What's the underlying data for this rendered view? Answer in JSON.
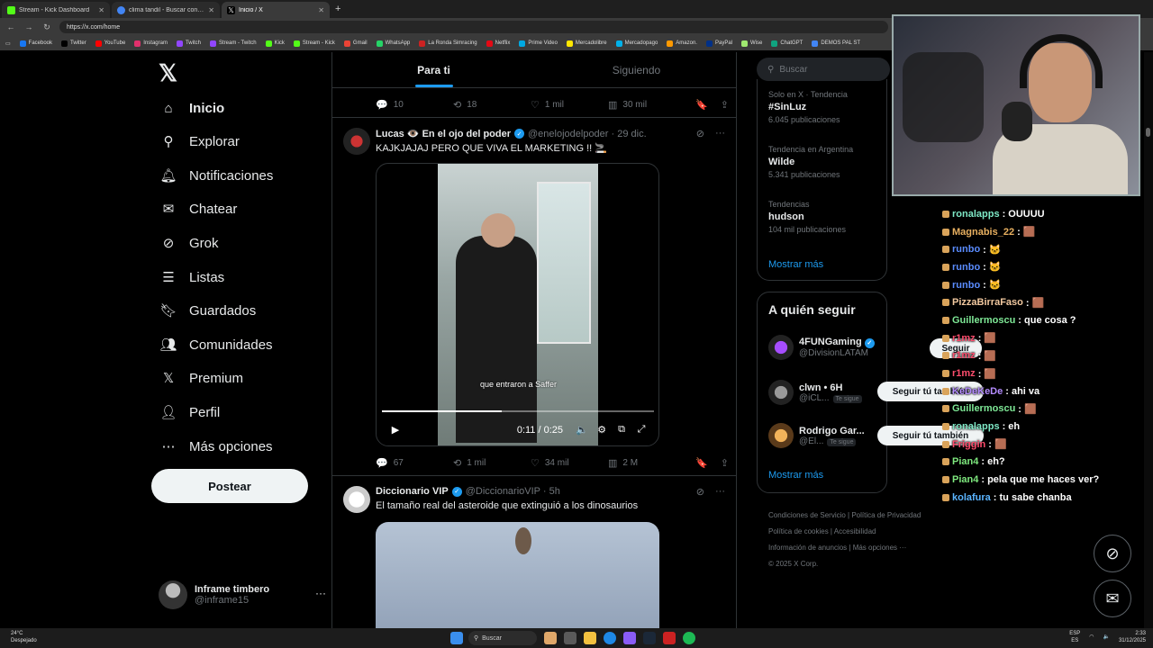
{
  "browser": {
    "tabs": [
      {
        "label": "Stream - Kick Dashboard",
        "color": "#53fc18"
      },
      {
        "label": "clima tandil - Buscar con Google",
        "color": "#4285f4"
      },
      {
        "label": "Inicio / X",
        "color": "#ffffff"
      }
    ],
    "url": "https://x.com/home",
    "bookmarks": [
      "Facebook",
      "Twitter",
      "YouTube",
      "Instagram",
      "Twitch",
      "Stream - Twitch",
      "Kick",
      "Stream - Kick",
      "Gmail",
      "WhatsApp",
      "La Ronda Simracing",
      "Netflix",
      "Prime Video",
      "Mercadolibre",
      "Mercadopago",
      "Amazon.",
      "PayPal",
      "Wise",
      "ChatGPT",
      "DEMOS PAL ST"
    ]
  },
  "nav": {
    "items": [
      {
        "label": "Inicio",
        "icon": "home-icon"
      },
      {
        "label": "Explorar",
        "icon": "search-icon"
      },
      {
        "label": "Notificaciones",
        "icon": "bell-icon"
      },
      {
        "label": "Chatear",
        "icon": "mail-icon"
      },
      {
        "label": "Grok",
        "icon": "grok-icon"
      },
      {
        "label": "Listas",
        "icon": "list-icon"
      },
      {
        "label": "Guardados",
        "icon": "bookmark-icon"
      },
      {
        "label": "Comunidades",
        "icon": "people-icon"
      },
      {
        "label": "Premium",
        "icon": "x-icon"
      },
      {
        "label": "Perfil",
        "icon": "person-icon"
      },
      {
        "label": "Más opciones",
        "icon": "more-icon"
      }
    ],
    "post_label": "Postear",
    "account": {
      "name": "Inframe timbero",
      "handle": "@inframe15"
    }
  },
  "feed": {
    "tabs": [
      "Para ti",
      "Siguiendo"
    ],
    "top_actions": {
      "replies": "10",
      "reposts": "18",
      "likes": "1 mil",
      "views": "30 mil"
    },
    "tweet1": {
      "name": "Lucas 👁️ En el ojo del poder",
      "handle": "@enelojodelpoder · 29 dic.",
      "text": "KAJKJAJAJ PERO QUE VIVA EL MARKETING !! 🚬",
      "caption": "que entraron a Saffer",
      "time": "0:11 / 0:25",
      "progress": 0.44,
      "actions": {
        "replies": "67",
        "reposts": "1 mil",
        "likes": "34 mil",
        "views": "2 M"
      }
    },
    "tweet2": {
      "name": "Diccionario VIP",
      "handle": "@DiccionarioVIP · 5h",
      "text": "El tamaño real del asteroide que extinguió a los dinosaurios"
    }
  },
  "right": {
    "search_placeholder": "Buscar",
    "trends": [
      {
        "meta": "Solo en X · Tendencia",
        "name": "#SinLuz",
        "count": "6.045 publicaciones"
      },
      {
        "meta": "Tendencia en Argentina",
        "name": "Wilde",
        "count": "5.341 publicaciones"
      },
      {
        "meta": "Tendencias",
        "name": "hudson",
        "count": "104 mil publicaciones"
      }
    ],
    "show_more": "Mostrar más",
    "who_to_follow": "A quién seguir",
    "suggestions": [
      {
        "name": "4FUNGaming",
        "handle": "@DivisionLATAM",
        "button": "Seguir",
        "follows_you": ""
      },
      {
        "name": "clwn • 6H",
        "handle": "@iCL...",
        "button": "Seguir tú también",
        "follows_you": "Te sigue"
      },
      {
        "name": "Rodrigo Gar...",
        "handle": "@El...",
        "button": "Seguir tú también",
        "follows_you": "Te sigue"
      }
    ],
    "show_more_2": "Mostrar más",
    "footer": {
      "line1": "Condiciones de Servicio  |  Política de Privacidad",
      "line2": "Política de cookies  |  Accesibilidad",
      "line3": "Información de anuncios  |  Más opciones ···",
      "line4": "© 2025 X Corp."
    }
  },
  "chat": [
    {
      "user": "ronalapps",
      "text": ": OUUUU",
      "color": "#7ee8c6"
    },
    {
      "user": "Magnabis_22",
      "text": ": 🟫",
      "color": "#e8b060"
    },
    {
      "user": "runbo",
      "text": ": 🐱",
      "color": "#5a8cff"
    },
    {
      "user": "runbo",
      "text": ": 🐱",
      "color": "#5a8cff"
    },
    {
      "user": "runbo",
      "text": ": 🐱",
      "color": "#5a8cff"
    },
    {
      "user": "PizzaBirraFaso",
      "text": ": 🟫",
      "color": "#f2c9a0"
    },
    {
      "user": "Guillermoscu",
      "text": ": que cosa ?",
      "color": "#7ee896"
    },
    {
      "user": "r1mz",
      "text": ": 🟫",
      "color": "#ff4d6d"
    },
    {
      "user": "r1mz",
      "text": ": 🟫",
      "color": "#ff4d6d"
    },
    {
      "user": "r1mz",
      "text": ": 🟫",
      "color": "#ff4d6d"
    },
    {
      "user": "KeDeKeDe",
      "text": ": ahi va",
      "color": "#b48cff"
    },
    {
      "user": "Guillermoscu",
      "text": ": 🟫",
      "color": "#7ee896"
    },
    {
      "user": "ronalapps",
      "text": ": eh",
      "color": "#7ee8c6"
    },
    {
      "user": "Friggin",
      "text": ": 🟫",
      "color": "#ff4d6d"
    },
    {
      "user": "Pian4",
      "text": ": eh?",
      "color": "#7ee87e"
    },
    {
      "user": "Pian4",
      "text": ": pela que me haces ver?",
      "color": "#7ee87e"
    },
    {
      "user": "kolafura",
      "text": ": tu sabe chanba",
      "color": "#5ab4ff"
    }
  ],
  "taskbar": {
    "weather_temp": "24°C",
    "weather_desc": "Despejado",
    "search_label": "Buscar",
    "lang": "ESP",
    "lang_sub": "ES",
    "time": "2:33",
    "date": "31/12/2025"
  }
}
